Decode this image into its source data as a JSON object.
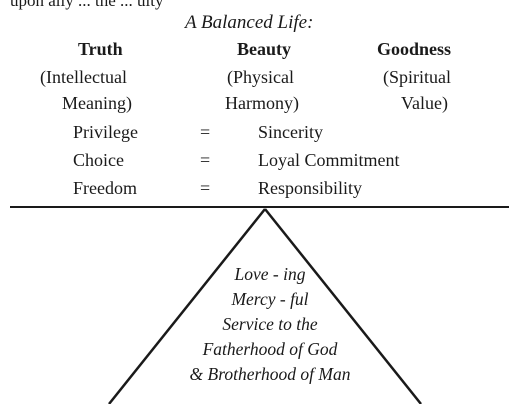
{
  "top_fragment": "upon ally ... the ... ulty",
  "title": "A Balanced Life:",
  "columns": [
    {
      "heading": "Truth",
      "sub1": "(Intellectual",
      "sub2": "Meaning)"
    },
    {
      "heading": "Beauty",
      "sub1": "(Physical",
      "sub2": "Harmony)"
    },
    {
      "heading": "Goodness",
      "sub1": "(Spiritual",
      "sub2": "Value)"
    }
  ],
  "equations": [
    {
      "left": "Privilege",
      "op": "=",
      "right": "Sincerity"
    },
    {
      "left": "Choice",
      "op": "=",
      "right": "Loyal Commitment"
    },
    {
      "left": "Freedom",
      "op": "=",
      "right": "Responsibility"
    }
  ],
  "triangle_lines": [
    "Love - ing",
    "Mercy - ful",
    "Service to the",
    "Fatherhood of God",
    "& Brotherhood of Man"
  ]
}
